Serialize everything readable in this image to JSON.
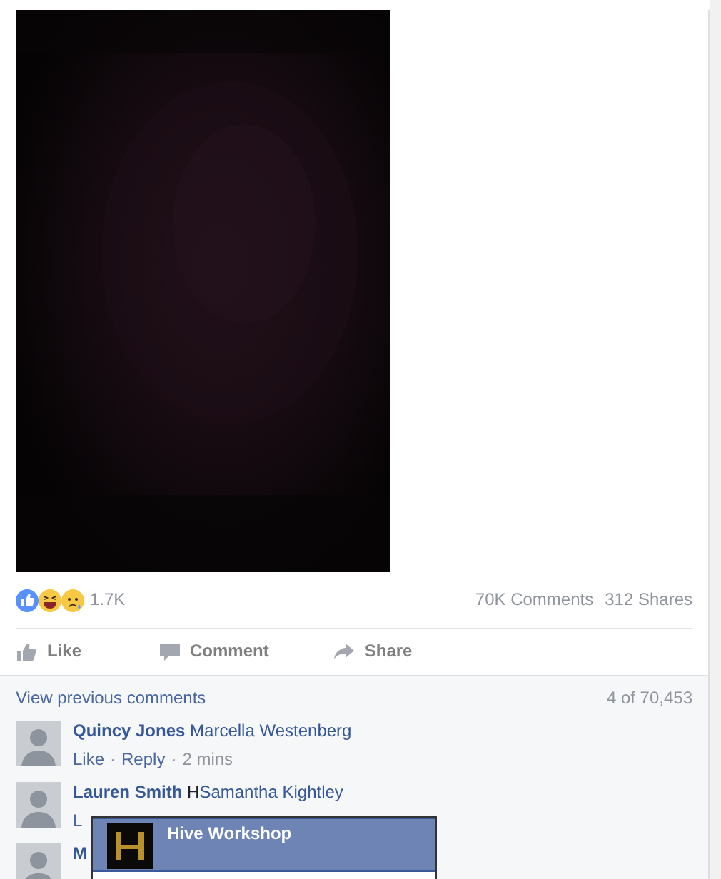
{
  "post": {
    "reactions": {
      "count": "1.7K",
      "icons": [
        {
          "kind": "like"
        },
        {
          "kind": "haha"
        },
        {
          "kind": "sad"
        }
      ]
    },
    "comments_count": "70K Comments",
    "shares_count": "312 Shares",
    "actions": [
      {
        "kind": "like",
        "label": "Like"
      },
      {
        "kind": "comment",
        "label": "Comment"
      },
      {
        "kind": "share",
        "label": "Share"
      }
    ]
  },
  "comments": {
    "view_previous": "View previous comments",
    "counter": "4 of 70,453",
    "items": [
      {
        "author": "Quincy Jones",
        "text": [
          {
            "kind": "tag",
            "text": "Marcella Westenberg"
          }
        ],
        "meta": [
          {
            "kind": "link",
            "text": "Like"
          },
          {
            "kind": "sep",
            "text": "·"
          },
          {
            "kind": "link",
            "text": "Reply"
          },
          {
            "kind": "sep",
            "text": "·"
          },
          {
            "kind": "time",
            "text": "2 mins"
          }
        ]
      },
      {
        "author": "Lauren Smith",
        "text": [
          {
            "kind": "plain",
            "text": "H"
          },
          {
            "kind": "tag",
            "text": "Samantha Kightley"
          }
        ],
        "meta": [
          {
            "kind": "link",
            "text": "L"
          }
        ]
      },
      {
        "author": "M"
      }
    ]
  },
  "mention_popup": {
    "items": [
      {
        "name": "Hive Workshop",
        "selected": true
      }
    ]
  }
}
